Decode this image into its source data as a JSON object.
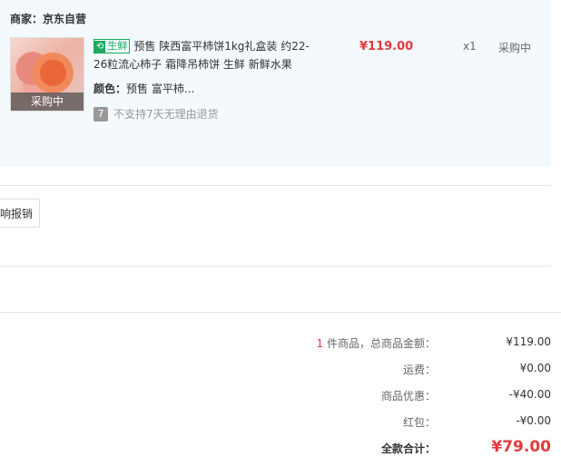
{
  "order": {
    "merchant_label": "商家：",
    "merchant_name": "京东自营",
    "item": {
      "thumb_badge": "采购中",
      "fresh_leaf": "⟲",
      "fresh_label": "生鲜",
      "title": "预售 陕西富平柿饼1kg礼盒装 约22-26粒流心柿子 霜降吊柿饼 生鲜 新鲜水果",
      "color_key": "颜色：",
      "color_value": "预售 富平柿...",
      "no_return_icon": "7",
      "no_return_text": "不支持7天无理由退货",
      "price": "¥119.00",
      "quantity": "x1",
      "status": "采购中"
    }
  },
  "actions": {
    "reimburse_label": "响报销"
  },
  "summary": {
    "count": "1",
    "count_suffix": " 件商品，总商品金额：",
    "subtotal": "¥119.00",
    "shipping_label": "运费：",
    "shipping": "¥0.00",
    "discount_label": "商品优惠：",
    "discount": "-¥40.00",
    "redpacket_label": "红包：",
    "redpacket": "-¥0.00",
    "total_label": "全款合计：",
    "total": "¥79.00"
  },
  "colors": {
    "accent_red": "#e4393c",
    "fresh_green": "#1aab5c",
    "panel_bg": "#f3f9fd"
  }
}
